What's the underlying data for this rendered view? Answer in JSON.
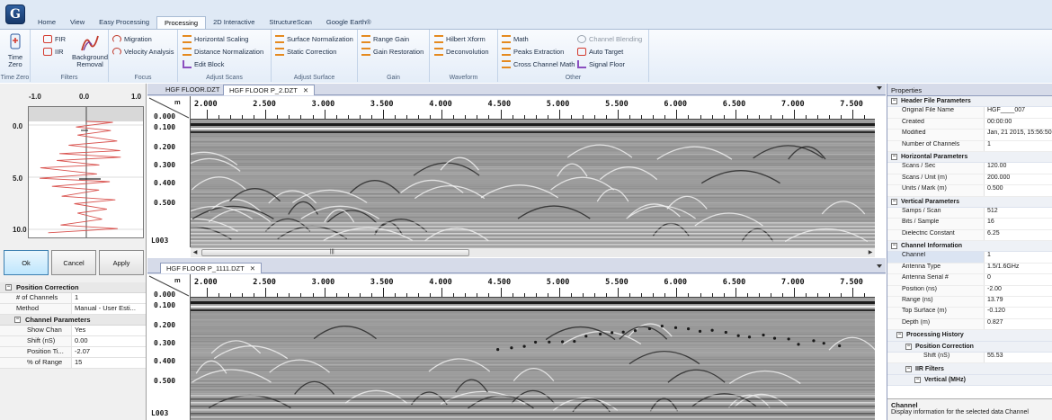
{
  "app": {
    "logo_letter": "G"
  },
  "ribbon": {
    "tabs": [
      {
        "label": "Home",
        "active": false
      },
      {
        "label": "View",
        "active": false
      },
      {
        "label": "Easy Processing",
        "active": false
      },
      {
        "label": "Processing",
        "active": true
      },
      {
        "label": "2D Interactive",
        "active": false
      },
      {
        "label": "StructureScan",
        "active": false
      },
      {
        "label": "Google Earth®",
        "active": false
      }
    ],
    "groups": {
      "time_zero": {
        "label": "Time Zero",
        "button": "Time\nZero"
      },
      "filters": {
        "label": "Filters",
        "fir": "FIR",
        "iir": "IIR",
        "background": "Background\nRemoval"
      },
      "focus": {
        "label": "Focus",
        "migration": "Migration",
        "velocity": "Velocity Analysis"
      },
      "adjust_scans": {
        "label": "Adjust Scans",
        "horizontal": "Horizontal Scaling",
        "distance": "Distance Normalization",
        "edit_block": "Edit Block"
      },
      "adjust_surface": {
        "label": "Adjust Surface",
        "surface_norm": "Surface Normalization",
        "static": "Static Correction"
      },
      "gain": {
        "label": "Gain",
        "range_gain": "Range Gain",
        "gain_restoration": "Gain Restoration"
      },
      "waveform": {
        "label": "Waveform",
        "hilbert": "Hilbert Xform",
        "deconvolution": "Deconvolution"
      },
      "other": {
        "label": "Other",
        "math": "Math",
        "peaks": "Peaks Extraction",
        "cross_channel": "Cross Channel Math",
        "channel_blending": "Channel Blending",
        "auto_target": "Auto Target",
        "signal_floor": "Signal Floor"
      }
    }
  },
  "left_panel": {
    "x_axis": [
      "-1.0",
      "0.0",
      "1.0"
    ],
    "y_axis": [
      "0.0",
      "5.0",
      "10.0"
    ],
    "buttons": {
      "ok": "Ok",
      "cancel": "Cancel",
      "apply": "Apply"
    },
    "properties": {
      "category": "Position Correction",
      "rows": [
        {
          "k": "# of Channels",
          "v": "1"
        },
        {
          "k": "Method",
          "v": "Manual - User Esti..."
        }
      ],
      "sub_category": "Channel Parameters",
      "sub_rows": [
        {
          "k": "Show Chan",
          "v": "Yes"
        },
        {
          "k": "Shift  (nS)",
          "v": "0.00"
        },
        {
          "k": "Position Ti...",
          "v": "-2.07"
        },
        {
          "k": "% of Range",
          "v": "15"
        }
      ]
    }
  },
  "documents": [
    {
      "tabs": [
        {
          "label": "HGF FLOOR.DZT",
          "active": false
        },
        {
          "label": "HGF FLOOR P_2.DZT",
          "active": true,
          "close": "✕"
        }
      ],
      "unit": "m",
      "distance_ticks": [
        "2.000",
        "2.500",
        "3.000",
        "3.500",
        "4.000",
        "4.500",
        "5.000",
        "5.500",
        "6.000",
        "6.500",
        "7.000",
        "7.500"
      ],
      "depth_ticks": [
        "0.000",
        "0.100",
        "0.200",
        "0.300",
        "0.400",
        "0.500"
      ],
      "mark_id": "L003",
      "scroll_glyph": "|||"
    },
    {
      "tabs": [
        {
          "label": "HGF FLOOR P_1111.DZT",
          "active": true,
          "close": "✕"
        }
      ],
      "unit": "m",
      "distance_ticks": [
        "2.000",
        "2.500",
        "3.000",
        "3.500",
        "4.000",
        "4.500",
        "5.000",
        "5.500",
        "6.000",
        "6.500",
        "7.000",
        "7.500"
      ],
      "depth_ticks": [
        "0.000",
        "0.100",
        "0.200",
        "0.300",
        "0.400",
        "0.500"
      ],
      "mark_id": "L003"
    }
  ],
  "properties": {
    "title": "Properties",
    "sections": [
      {
        "cat": "Header File Parameters",
        "rows": [
          {
            "k": "Original File Name",
            "v": "HGF____007"
          },
          {
            "k": "Created",
            "v": "00:00:00"
          },
          {
            "k": "Modified",
            "v": "Jan, 21 2015, 15:56:50"
          },
          {
            "k": "Number of Channels",
            "v": "1"
          }
        ]
      },
      {
        "cat": "Horizontal Parameters",
        "rows": [
          {
            "k": "Scans / Sec",
            "v": "120.00"
          },
          {
            "k": "Scans / Unit (m)",
            "v": "200.000"
          },
          {
            "k": "Units / Mark (m)",
            "v": "0.500"
          }
        ]
      },
      {
        "cat": "Vertical Parameters",
        "rows": [
          {
            "k": "Samps / Scan",
            "v": "512"
          },
          {
            "k": "Bits / Sample",
            "v": "16"
          },
          {
            "k": "Dielectric Constant",
            "v": "6.25"
          }
        ]
      },
      {
        "cat": "Channel Information",
        "rows": [
          {
            "k": "Channel",
            "v": "1",
            "sel": true
          },
          {
            "k": "Antenna Type",
            "v": "1.5/1.6GHz"
          },
          {
            "k": "Antenna Serial #",
            "v": "0"
          },
          {
            "k": "Position (ns)",
            "v": "-2.00"
          },
          {
            "k": "Range (ns)",
            "v": "13.79"
          },
          {
            "k": "Top Surface (m)",
            "v": "-0.120"
          },
          {
            "k": "Depth (m)",
            "v": "0.827"
          }
        ]
      }
    ],
    "history": {
      "cat": "Processing History",
      "pos_cat": "Position Correction",
      "shift_k": "Shift  (nS)",
      "shift_v": "55.53",
      "iir_cat": "IIR Filters",
      "vertical_cat": "Vertical   (MHz)"
    },
    "description": {
      "title": "Channel",
      "text": "Display information for the selected data Channel"
    }
  },
  "colors": {
    "ribbon_bg": "#dfe9f5",
    "accent": "#1e3553",
    "trace": "#d9534f",
    "panel_frame": "#d6dbe9"
  }
}
